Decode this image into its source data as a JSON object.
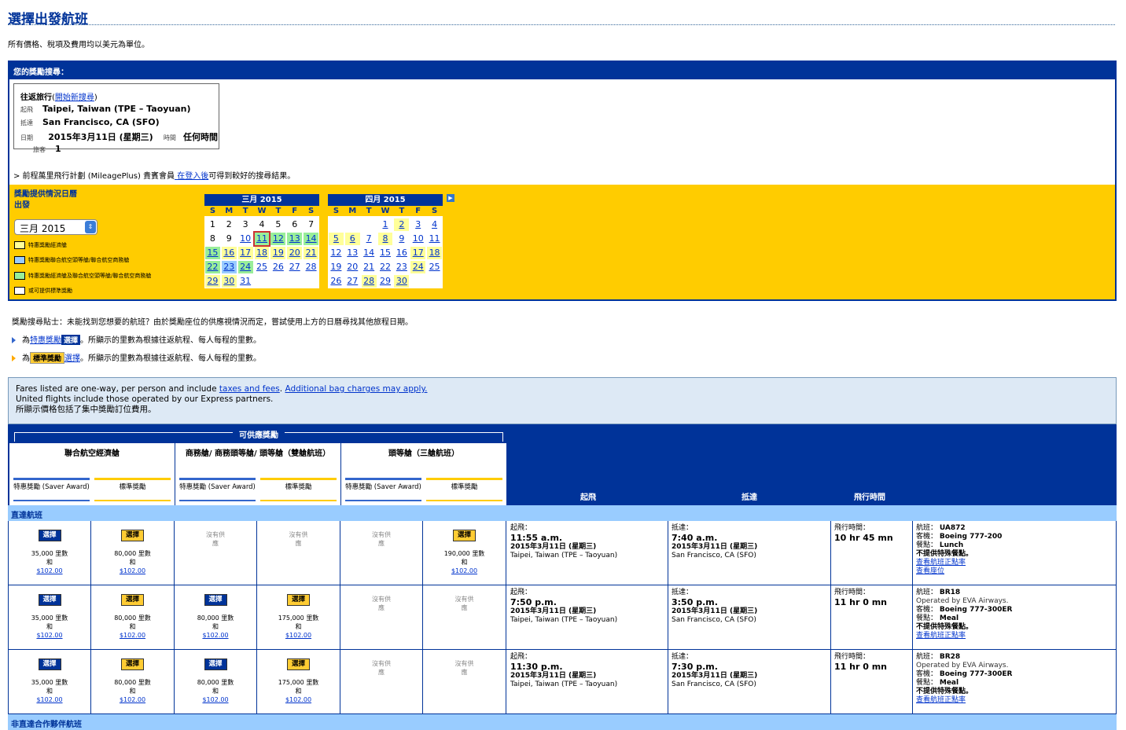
{
  "page": {
    "title": "選擇出發航班",
    "currency_note": "所有價格、稅項及費用均以美元為單位。"
  },
  "search": {
    "header": "您的獎勵搜尋：",
    "trip_type": "往返旅行",
    "new_search": "開始新搜尋",
    "depart_label": "起飛",
    "depart_value": "Taipei, Taiwan (TPE – Taoyuan)",
    "arrive_label": "抵達",
    "arrive_value": "San Francisco, CA (SFO)",
    "date_label": "日期",
    "date_value": "2015年3月11日 (星期三)",
    "time_label": "時間",
    "time_value": "任何時間",
    "pax_label": "旅客",
    "pax_value": "1",
    "mp_prefix": "> 前程萬里飛行計劃 (MileagePlus) 貴賓會員",
    "mp_link": " 在登入後",
    "mp_suffix": "可得到較好的搜尋結果。"
  },
  "calendar": {
    "title_line1": "獎勵提供情況日曆",
    "title_line2": "出發",
    "month_select": "三月 2015",
    "legend": [
      {
        "label": "特惠獎勵經濟艙",
        "color": "#ffff99"
      },
      {
        "label": "特惠獎勵聯合航空頭等艙/聯合航空商務艙",
        "color": "#99ccff"
      },
      {
        "label": "特惠獎勵經濟艙及聯合航空頭等艙/聯合航空商務艙",
        "color": "#99ee99"
      },
      {
        "label": "或可提供標準獎勵",
        "color": "#ffffff"
      }
    ],
    "weekdays": [
      "S",
      "M",
      "T",
      "W",
      "T",
      "F",
      "S"
    ],
    "months": [
      {
        "name": "三月  2015",
        "offset": 0,
        "days": [
          {
            "n": "1",
            "t": ""
          },
          {
            "n": "2",
            "t": ""
          },
          {
            "n": "3",
            "t": ""
          },
          {
            "n": "4",
            "t": ""
          },
          {
            "n": "5",
            "t": ""
          },
          {
            "n": "6",
            "t": ""
          },
          {
            "n": "7",
            "t": ""
          },
          {
            "n": "8",
            "t": ""
          },
          {
            "n": "9",
            "t": ""
          },
          {
            "n": "10",
            "t": "w"
          },
          {
            "n": "11",
            "t": "g sel"
          },
          {
            "n": "12",
            "t": "g"
          },
          {
            "n": "13",
            "t": "g"
          },
          {
            "n": "14",
            "t": "g"
          },
          {
            "n": "15",
            "t": "g"
          },
          {
            "n": "16",
            "t": "y"
          },
          {
            "n": "17",
            "t": "y"
          },
          {
            "n": "18",
            "t": "y"
          },
          {
            "n": "19",
            "t": "y"
          },
          {
            "n": "20",
            "t": "y"
          },
          {
            "n": "21",
            "t": "y"
          },
          {
            "n": "22",
            "t": "g"
          },
          {
            "n": "23",
            "t": "b"
          },
          {
            "n": "24",
            "t": "g"
          },
          {
            "n": "25",
            "t": "w"
          },
          {
            "n": "26",
            "t": "w"
          },
          {
            "n": "27",
            "t": "w"
          },
          {
            "n": "28",
            "t": "w"
          },
          {
            "n": "29",
            "t": "y"
          },
          {
            "n": "30",
            "t": "y"
          },
          {
            "n": "31",
            "t": "w"
          }
        ]
      },
      {
        "name": "四月  2015",
        "offset": 3,
        "days": [
          {
            "n": "1",
            "t": "w"
          },
          {
            "n": "2",
            "t": "y"
          },
          {
            "n": "3",
            "t": "w"
          },
          {
            "n": "4",
            "t": "w"
          },
          {
            "n": "5",
            "t": "y"
          },
          {
            "n": "6",
            "t": "y"
          },
          {
            "n": "7",
            "t": "w"
          },
          {
            "n": "8",
            "t": "y"
          },
          {
            "n": "9",
            "t": "w"
          },
          {
            "n": "10",
            "t": "w"
          },
          {
            "n": "11",
            "t": "w"
          },
          {
            "n": "12",
            "t": "w"
          },
          {
            "n": "13",
            "t": "w"
          },
          {
            "n": "14",
            "t": "w"
          },
          {
            "n": "15",
            "t": "w"
          },
          {
            "n": "16",
            "t": "w"
          },
          {
            "n": "17",
            "t": "y"
          },
          {
            "n": "18",
            "t": "y"
          },
          {
            "n": "19",
            "t": "w"
          },
          {
            "n": "20",
            "t": "w"
          },
          {
            "n": "21",
            "t": "w"
          },
          {
            "n": "22",
            "t": "w"
          },
          {
            "n": "23",
            "t": "w"
          },
          {
            "n": "24",
            "t": "y"
          },
          {
            "n": "25",
            "t": "w"
          },
          {
            "n": "26",
            "t": "w"
          },
          {
            "n": "27",
            "t": "w"
          },
          {
            "n": "28",
            "t": "y"
          },
          {
            "n": "29",
            "t": "w"
          },
          {
            "n": "30",
            "t": "y"
          }
        ]
      }
    ]
  },
  "tips": {
    "tip_text": "獎勵搜尋貼士：未能找到您想要的航班？由於獎勵座位的供應視情況而定，嘗試使用上方的日曆尋找其他旅程日期。",
    "saver_prefix": "為",
    "saver_link": "特惠獎勵",
    "saver_tag": "選擇",
    "saver_suffix": "。所顯示的里數為根據往返航程、每人每程的里數。",
    "std_prefix": "為",
    "std_tag": "標準獎勵",
    "std_link": "選擇",
    "std_suffix": "。所顯示的里數為根據往返航程、每人每程的里數。"
  },
  "fares_note": {
    "line1_prefix": "Fares listed are one-way, per person and include ",
    "taxes_link": "taxes and fees",
    "bag_link": "Additional bag charges may apply.",
    "line2": "United flights include those operated by our Express partners.",
    "line3": "所顯示價格包括了集中獎勵訂位費用。"
  },
  "table": {
    "avail_title": "可供應獎勵",
    "cabins": [
      "聯合航空經濟艙",
      "商務艙/ 商務頭等艙/ 頭等艙（雙艙航班）",
      "頭等艙（三艙航班）"
    ],
    "saver_label": "特惠獎勵 (Saver Award)",
    "std_label": "標準獎勵",
    "col_depart": "起飛",
    "col_arrive": "抵達",
    "col_duration": "飛行時間",
    "section_nonstop": "直達航班",
    "section_partner": "非直達合作夥伴航班",
    "select_label": "選擇",
    "na_label": "沒有供應",
    "miles_unit": "里數",
    "and_label": "和",
    "depart_prefix": "起飛：",
    "arrive_prefix": "抵達：",
    "duration_prefix": "飛行時間：",
    "flight_prefix": "航班：",
    "aircraft_prefix": "客機：",
    "meal_prefix": "餐點：",
    "no_special_meal": "不提供特殊餐點。",
    "on_time_link": "查看航班正點率",
    "seat_link": "查看座位"
  },
  "flights": [
    {
      "prices": [
        {
          "type": "saver",
          "miles": "35,000",
          "fee": "$102.00"
        },
        {
          "type": "std",
          "miles": "80,000",
          "fee": "$102.00"
        },
        {
          "type": "na"
        },
        {
          "type": "na"
        },
        {
          "type": "na"
        },
        {
          "type": "std",
          "miles": "190,000",
          "fee": "$102.00"
        }
      ],
      "dep_time": "11:55 a.m.",
      "dep_date": "2015年3月11日 (星期三)",
      "dep_city": "Taipei, Taiwan (TPE – Taoyuan)",
      "arr_time": "7:40 a.m.",
      "arr_date": "2015年3月11日 (星期三)",
      "arr_city": "San Francisco, CA (SFO)",
      "duration": "10 hr 45 mn",
      "flight": "UA872",
      "operated": "",
      "aircraft": "Boeing 777-200",
      "meal": "Lunch",
      "seat_link": true
    },
    {
      "prices": [
        {
          "type": "saver",
          "miles": "35,000",
          "fee": "$102.00"
        },
        {
          "type": "std",
          "miles": "80,000",
          "fee": "$102.00"
        },
        {
          "type": "saver",
          "miles": "80,000",
          "fee": "$102.00"
        },
        {
          "type": "std",
          "miles": "175,000",
          "fee": "$102.00"
        },
        {
          "type": "na"
        },
        {
          "type": "na"
        }
      ],
      "dep_time": "7:50 p.m.",
      "dep_date": "2015年3月11日 (星期三)",
      "dep_city": "Taipei, Taiwan (TPE – Taoyuan)",
      "arr_time": "3:50 p.m.",
      "arr_date": "2015年3月11日 (星期三)",
      "arr_city": "San Francisco, CA (SFO)",
      "duration": "11 hr 0 mn",
      "flight": "BR18",
      "operated": "Operated by EVA Airways.",
      "aircraft": "Boeing 777-300ER",
      "meal": "Meal",
      "seat_link": false
    },
    {
      "prices": [
        {
          "type": "saver",
          "miles": "35,000",
          "fee": "$102.00"
        },
        {
          "type": "std",
          "miles": "80,000",
          "fee": "$102.00"
        },
        {
          "type": "saver",
          "miles": "80,000",
          "fee": "$102.00"
        },
        {
          "type": "std",
          "miles": "175,000",
          "fee": "$102.00"
        },
        {
          "type": "na"
        },
        {
          "type": "na"
        }
      ],
      "dep_time": "11:30 p.m.",
      "dep_date": "2015年3月11日 (星期三)",
      "dep_city": "Taipei, Taiwan (TPE – Taoyuan)",
      "arr_time": "7:30 p.m.",
      "arr_date": "2015年3月11日 (星期三)",
      "arr_city": "San Francisco, CA (SFO)",
      "duration": "11 hr 0 mn",
      "flight": "BR28",
      "operated": "Operated by EVA Airways.",
      "aircraft": "Boeing 777-300ER",
      "meal": "Meal",
      "seat_link": false
    }
  ]
}
